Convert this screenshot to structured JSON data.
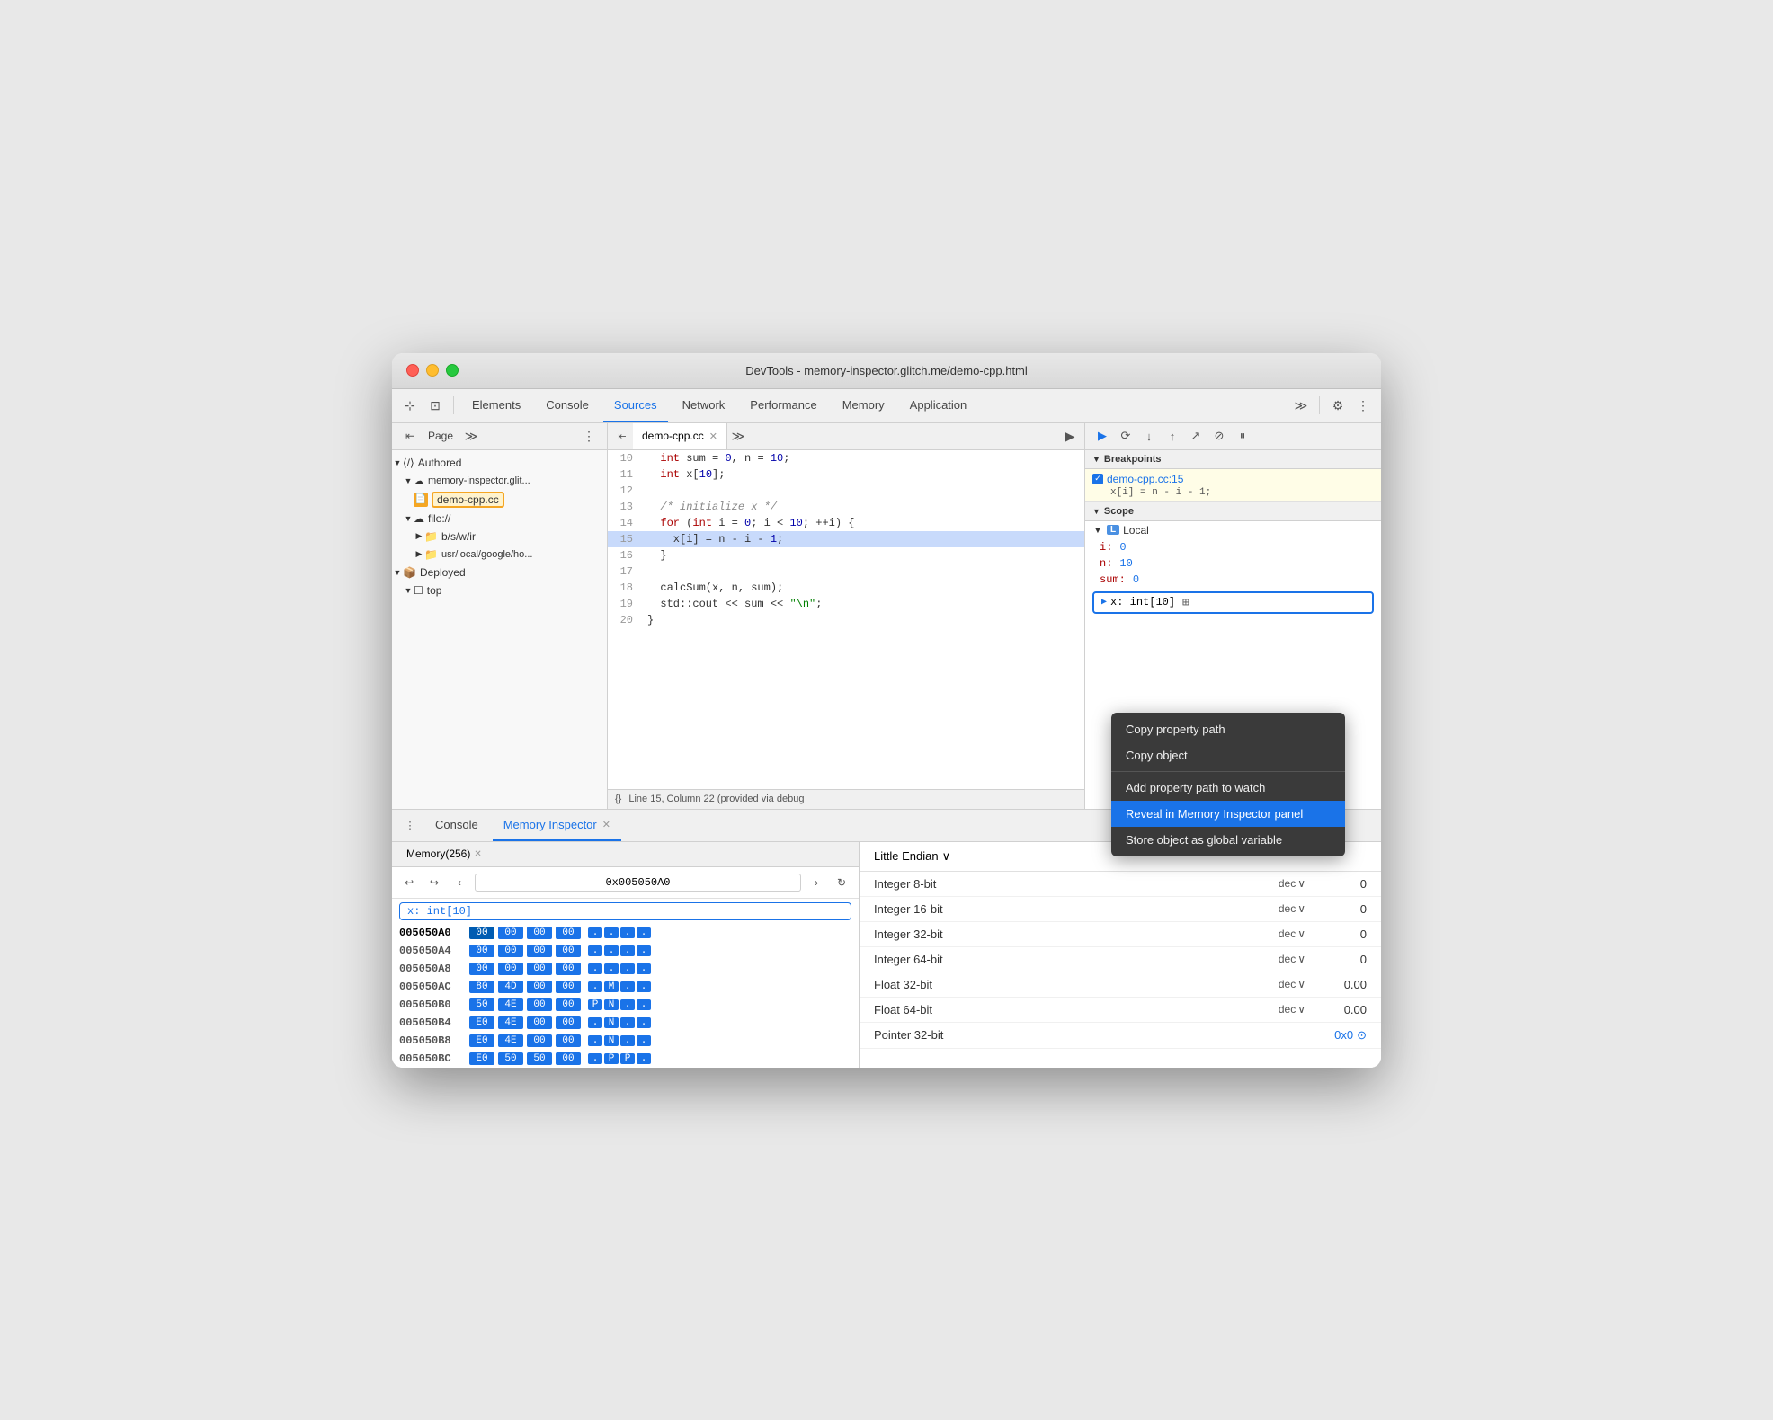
{
  "window": {
    "title": "DevTools - memory-inspector.glitch.me/demo-cpp.html"
  },
  "toolbar": {
    "tabs": [
      "Elements",
      "Console",
      "Sources",
      "Network",
      "Performance",
      "Memory",
      "Application"
    ],
    "active_tab": "Sources"
  },
  "sidebar": {
    "label": "Page",
    "tree": [
      {
        "label": "Authored",
        "type": "group",
        "indent": 0,
        "expanded": true
      },
      {
        "label": "memory-inspector.glit...",
        "type": "domain",
        "indent": 1,
        "expanded": true
      },
      {
        "label": "demo-cpp.cc",
        "type": "file",
        "indent": 2,
        "highlighted": true
      },
      {
        "label": "file://",
        "type": "domain",
        "indent": 1,
        "expanded": true
      },
      {
        "label": "b/s/w/ir",
        "type": "folder",
        "indent": 2
      },
      {
        "label": "usr/local/google/ho...",
        "type": "folder",
        "indent": 2
      },
      {
        "label": "Deployed",
        "type": "group",
        "indent": 0,
        "expanded": true
      },
      {
        "label": "top",
        "type": "frame",
        "indent": 1,
        "expanded": true
      }
    ]
  },
  "code_panel": {
    "tab_name": "demo-cpp.cc",
    "lines": [
      {
        "num": 10,
        "code": "  int sum = 0, n = 10;"
      },
      {
        "num": 11,
        "code": "  int x[10];"
      },
      {
        "num": 12,
        "code": ""
      },
      {
        "num": 13,
        "code": "  /* initialize x */"
      },
      {
        "num": 14,
        "code": "  for (int i = 0; i < 10; ++i) {"
      },
      {
        "num": 15,
        "code": "    x[i] = n - i - 1;",
        "highlighted": true
      },
      {
        "num": 16,
        "code": "  }"
      },
      {
        "num": 17,
        "code": ""
      },
      {
        "num": 18,
        "code": "  calcSum(x, n, sum);"
      },
      {
        "num": 19,
        "code": "  std::cout << sum << \"\\n\";"
      },
      {
        "num": 20,
        "code": "}"
      }
    ],
    "statusbar": "Line 15, Column 22 (provided via debug"
  },
  "right_panel": {
    "breakpoints_header": "Breakpoints",
    "breakpoint": {
      "file": "demo-cpp.cc:15",
      "code": "x[i] = n - i - 1;"
    },
    "scope_header": "Scope",
    "scope_local": "Local",
    "scope_vars": [
      {
        "name": "i:",
        "value": "0"
      },
      {
        "name": "n:",
        "value": "10"
      },
      {
        "name": "sum:",
        "value": "0"
      }
    ],
    "x_tooltip": {
      "arrow": "▶",
      "text": "x: int[10]",
      "icon": "⊞"
    }
  },
  "context_menu": {
    "items": [
      {
        "label": "Copy property path",
        "type": "item"
      },
      {
        "label": "Copy object",
        "type": "item"
      },
      {
        "label": "",
        "type": "divider"
      },
      {
        "label": "Add property path to watch",
        "type": "item"
      },
      {
        "label": "Reveal in Memory Inspector panel",
        "type": "item",
        "selected": true
      },
      {
        "label": "Store object as global variable",
        "type": "item"
      }
    ]
  },
  "bottom_panel": {
    "tabs": [
      "Console",
      "Memory Inspector"
    ],
    "active_tab": "Memory Inspector",
    "memory_subtab": "Memory(256)"
  },
  "memory_inspector": {
    "address": "0x005050A0",
    "tag": "x: int[10]",
    "rows": [
      {
        "addr": "005050A0",
        "bold": true,
        "bytes": [
          "00",
          "00",
          "00",
          "00"
        ],
        "ascii": [
          ".",
          ".",
          ".",
          "."
        ]
      },
      {
        "addr": "005050A4",
        "bytes": [
          "00",
          "00",
          "00",
          "00"
        ],
        "ascii": [
          ".",
          ".",
          ".",
          "."
        ]
      },
      {
        "addr": "005050A8",
        "bytes": [
          "00",
          "00",
          "00",
          "00"
        ],
        "ascii": [
          ".",
          ".",
          ".",
          "."
        ]
      },
      {
        "addr": "005050AC",
        "bytes": [
          "80",
          "4D",
          "00",
          "00"
        ],
        "ascii": [
          ".",
          "M",
          ".",
          "."
        ]
      },
      {
        "addr": "005050B0",
        "bytes": [
          "50",
          "4E",
          "00",
          "00"
        ],
        "ascii": [
          "P",
          "N",
          ".",
          "."
        ]
      },
      {
        "addr": "005050B4",
        "bytes": [
          "E0",
          "4E",
          "00",
          "00"
        ],
        "ascii": [
          ".",
          "N",
          ".",
          "."
        ]
      },
      {
        "addr": "005050B8",
        "bytes": [
          "E0",
          "4E",
          "00",
          "00"
        ],
        "ascii": [
          ".",
          "N",
          ".",
          "."
        ]
      },
      {
        "addr": "005050BC",
        "bytes": [
          "E0",
          "50",
          "50",
          "00"
        ],
        "ascii": [
          ".",
          "P",
          "P",
          "."
        ]
      }
    ]
  },
  "data_panel": {
    "endian": "Little Endian",
    "rows": [
      {
        "label": "Integer 8-bit",
        "format": "dec",
        "value": "0"
      },
      {
        "label": "Integer 16-bit",
        "format": "dec",
        "value": "0"
      },
      {
        "label": "Integer 32-bit",
        "format": "dec",
        "value": "0"
      },
      {
        "label": "Integer 64-bit",
        "format": "dec",
        "value": "0"
      },
      {
        "label": "Float 32-bit",
        "format": "dec",
        "value": "0.00"
      },
      {
        "label": "Float 64-bit",
        "format": "dec",
        "value": "0.00"
      },
      {
        "label": "Pointer 32-bit",
        "format": "",
        "value": "0x0"
      }
    ]
  }
}
